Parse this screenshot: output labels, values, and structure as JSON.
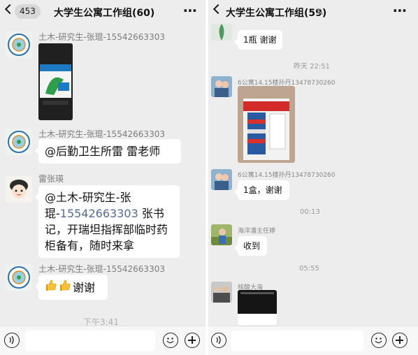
{
  "left": {
    "unread_badge": "453",
    "title": "大学生公寓工作组(60)",
    "messages": [
      {
        "sender": "土木-研究生-张琨-15542663303",
        "type": "image"
      },
      {
        "sender": "土木-研究生-张琨-15542663303",
        "text": "@后勤卫生所雷 雷老师"
      },
      {
        "sender": "雷张瑛",
        "text_prefix": "@土木-研究生-张琨-",
        "text_link": "15542663303",
        "text_suffix": " 张书记，开瑞坦指挥部临时药柜备有，随时来拿"
      },
      {
        "sender": "土木-研究生-张琨-15542663303",
        "text": "谢谢"
      }
    ],
    "time_partial": "下午3:41"
  },
  "right": {
    "title": "大学生公寓工作组(59)",
    "first_bubble": "1瓶 谢谢",
    "time_1": "昨天 22:51",
    "messages": [
      {
        "sender": "6公寓14.15楼孙丹13478730260",
        "type": "image"
      },
      {
        "sender": "6公寓14.15楼孙丹13478730260",
        "text": "1盒，谢谢"
      }
    ],
    "time_2": "00:13",
    "msg_3": {
      "sender": "海洋潘主任婷",
      "text": "收到"
    },
    "time_3": "05:55",
    "msg_4": {
      "sender": "核酸大海"
    }
  },
  "colors": {
    "background": "#ededed",
    "bubble": "#ffffff",
    "link": "#576b95",
    "meta_text": "#9a9a9a"
  },
  "icons": [
    "back-icon",
    "more-icon",
    "mute-icon",
    "voice-icon",
    "emoji-icon",
    "add-icon",
    "thumbs-up-icon"
  ]
}
